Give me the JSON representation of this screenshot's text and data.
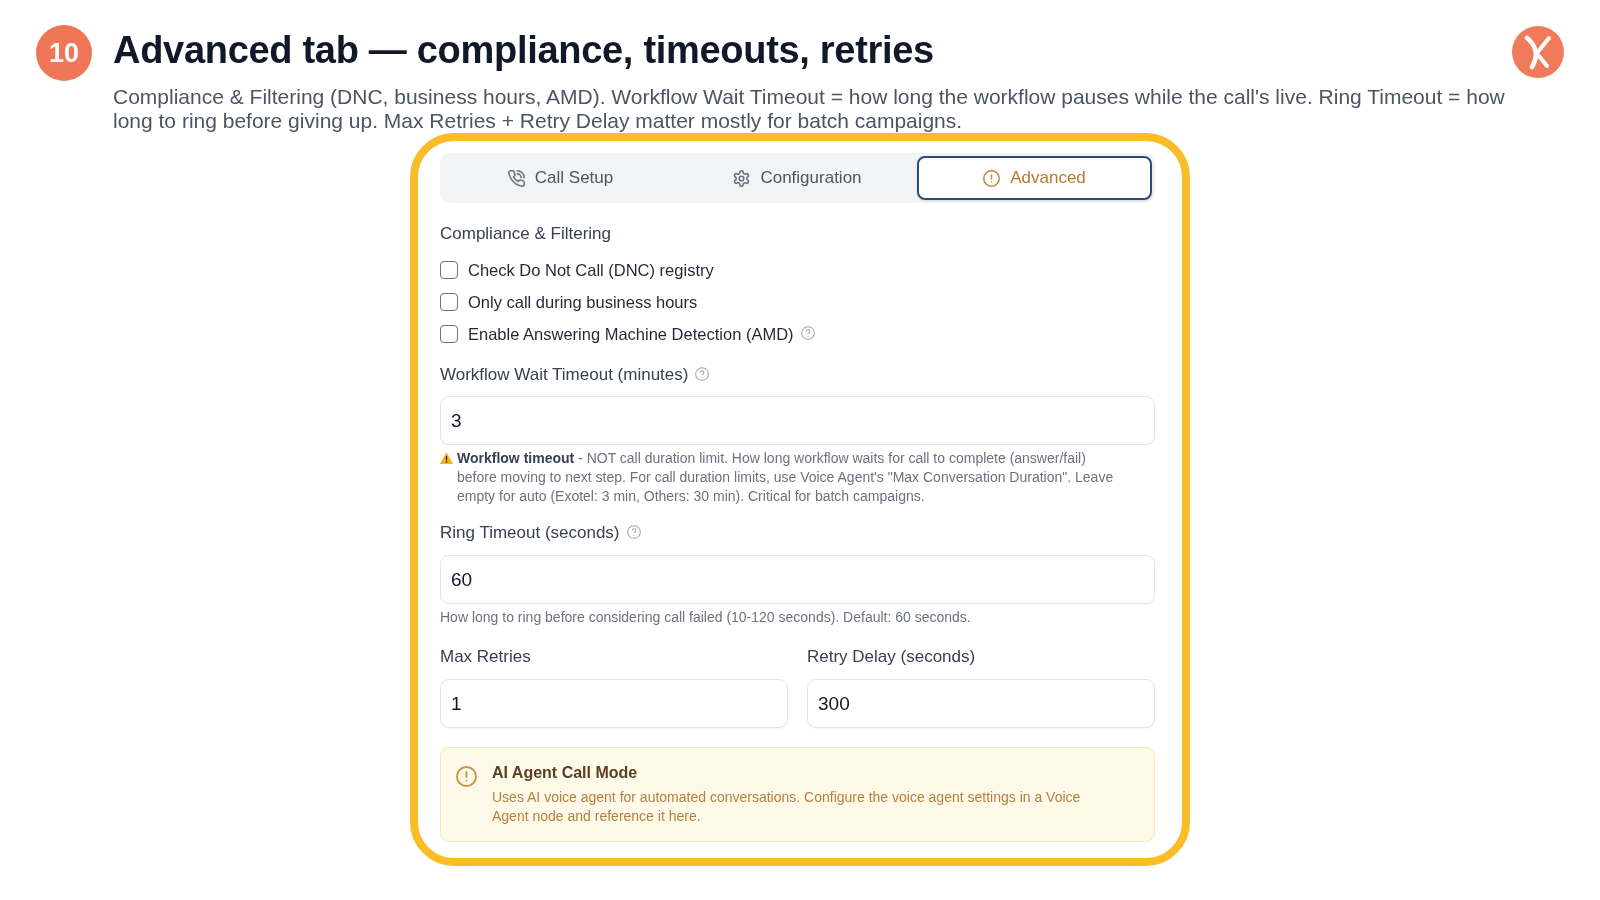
{
  "slide": {
    "number": "10",
    "title": "Advanced tab — compliance, timeouts, retries",
    "subtitle": "Compliance & Filtering (DNC, business hours, AMD). Workflow Wait Timeout = how long the workflow pauses while the call's live. Ring Timeout = how long to ring before giving up. Max Retries + Retry Delay matter mostly for batch campaigns."
  },
  "screenshot": {
    "tabs": [
      {
        "label": "Call Setup",
        "selected": false
      },
      {
        "label": "Configuration",
        "selected": false
      },
      {
        "label": "Advanced",
        "selected": true
      }
    ],
    "section_title": "Compliance & Filtering",
    "checkboxes": [
      {
        "label": "Check Do Not Call (DNC) registry",
        "checked": false,
        "help": false
      },
      {
        "label": "Only call during business hours",
        "checked": false,
        "help": false
      },
      {
        "label": "Enable Answering Machine Detection (AMD)",
        "checked": false,
        "help": true
      }
    ],
    "workflow_wait_timeout": {
      "label": "Workflow Wait Timeout (minutes)",
      "help": true,
      "value": "3",
      "note": {
        "kind": "warning",
        "text": "**Workflow timeout** - NOT call duration limit. How long workflow waits for call to complete (answer/fail) before moving to next step. For call duration limits, use Voice Agent's \"Max Conversation Duration\". Leave empty for auto (Exotel: 3 min, Others: 30 min). Critical for batch campaigns."
      }
    },
    "ring_timeout": {
      "label": "Ring Timeout (seconds)",
      "help": true,
      "value": "60",
      "note": {
        "kind": "hint",
        "text": "How long to ring before considering call failed (10-120 seconds). Default: 60 seconds."
      }
    },
    "retry_fields": [
      {
        "label": "Max Retries",
        "help": false,
        "value": "1"
      },
      {
        "label": "Retry Delay (seconds)",
        "help": false,
        "value": "300"
      }
    ],
    "notice": {
      "title": "AI Agent Call Mode",
      "text": "Uses AI voice agent for automated conversations. Configure the voice agent settings in a Voice Agent node and reference it here."
    }
  }
}
